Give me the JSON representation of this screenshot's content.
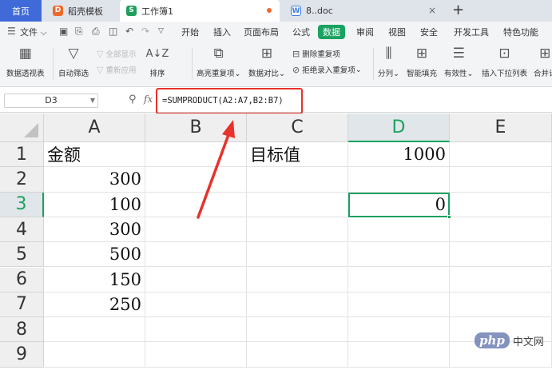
{
  "tabs": {
    "home": "首页",
    "template": "稻壳模板",
    "workbook": "工作簿1",
    "doc": "8..doc",
    "add": "+",
    "close": "×",
    "icon_template": "D",
    "icon_workbook": "S",
    "icon_doc": "W"
  },
  "menu": {
    "file": "文件",
    "items": [
      "开始",
      "插入",
      "页面布局",
      "公式",
      "数据",
      "审阅",
      "视图",
      "安全",
      "开发工具",
      "特色功能"
    ],
    "active_index": 4
  },
  "ribbon": {
    "pivot_table": "数据透视表",
    "auto_filter": "自动筛选",
    "show_all": "全部显示",
    "reapply": "重新应用",
    "sort": "排序",
    "highlight_dup": "高亮重复项",
    "data_compare": "数据对比",
    "delete_dup": "删除重复项",
    "reject_dup": "拒绝录入重复项",
    "split": "分列",
    "smart_fill": "智能填充",
    "validity": "有效性",
    "insert_dropdown": "插入下拉列表",
    "merge_calc": "合并计"
  },
  "formula_bar": {
    "cell_ref": "D3",
    "fx_label": "fx",
    "formula": "=SUMPRODUCT(A2:A7,B2:B7)"
  },
  "sheet": {
    "columns": [
      "A",
      "B",
      "C",
      "D",
      "E"
    ],
    "rows": [
      "1",
      "2",
      "3",
      "4",
      "5",
      "6",
      "7",
      "8",
      "9"
    ],
    "active_col": "D",
    "active_row": "3",
    "cells": {
      "A1": "金额",
      "A2": "300",
      "A3": "100",
      "A4": "300",
      "A5": "500",
      "A6": "150",
      "A7": "250",
      "C1": "目标值",
      "D1": "1000",
      "D3": "0"
    }
  },
  "accent_color": "#1aa260",
  "highlight_color": "#e8322b",
  "watermark": {
    "logo": "php",
    "text": "中文网"
  }
}
